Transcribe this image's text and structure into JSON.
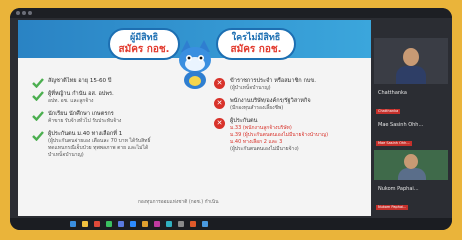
{
  "slide": {
    "bubble_left": {
      "line1": "ผู้มีสิทธิ",
      "line2": "สมัคร กอช."
    },
    "bubble_right": {
      "line1": "ใครไม่มีสิทธิ",
      "line2": "สมัคร กอช."
    },
    "eligible": [
      {
        "text": "สัญชาติไทย อายุ 15-60 ปี",
        "sub": ""
      },
      {
        "text": "ผู้ที่หญ้าน กำนัน อส. อปพร.",
        "sub": "อปท. อช. และลูกจ้าง"
      },
      {
        "text": "นักเรียน นักศึกษา เกษตรกร",
        "sub": "ค้าขาย รับจ้างทั่วไป รับประทับจ้าง"
      },
      {
        "text": "ผู้ประกันตน ม.40 ทางเลือกที่ 1",
        "sub": "(ผู้ประกันตนจ่ายเอง เดือนละ 70 บาท ได้รับสิทธิ์ทดแทนกรณีเจ็บป่วย ทุพพลภาพ ตาย และไม่ได้บำเหน็จบำนาญ)"
      }
    ],
    "ineligible": [
      {
        "text": "ข้าราชการประจำ หรือสมาชิก กบข.",
        "sub": "(ผู้บำเหน็จบำนาญ)"
      },
      {
        "text": "พนักงานบริษัท/องค์กร/รัฐวิสาหกิจ",
        "sub": "(มีกองทุนสำรองเลี้ยงชีพ)"
      },
      {
        "text": "ผู้ประกันตน",
        "sub": "ม.33 (พนักงานลูกจ้างบริษัท)",
        "sub2": "ม.39 (ผู้ประกันตนตนเองไม่มีนายจ้างนำบาญ)",
        "sub3": "ม.40 ทางเลือก 2 และ 3",
        "sub4": "(ผู้ประกันตนตนเองไม่มีนายจ้าง)"
      }
    ],
    "footer": "กองทุนการออมแห่งชาติ (กอช.) กำเนิน"
  },
  "participants": [
    {
      "name": "Chatthanka",
      "tag": "Chatthanka"
    },
    {
      "name": "Mae Sasinh Ohh...",
      "tag": "Mae Sasinh Ohh..."
    },
    {
      "name": "Nukom Paphai...",
      "tag": "Nukom Paphai..."
    }
  ],
  "colors": {
    "background": "#eab43a",
    "accent": "#1d6fb2",
    "alert": "#d8322a",
    "check": "#4caf50"
  }
}
